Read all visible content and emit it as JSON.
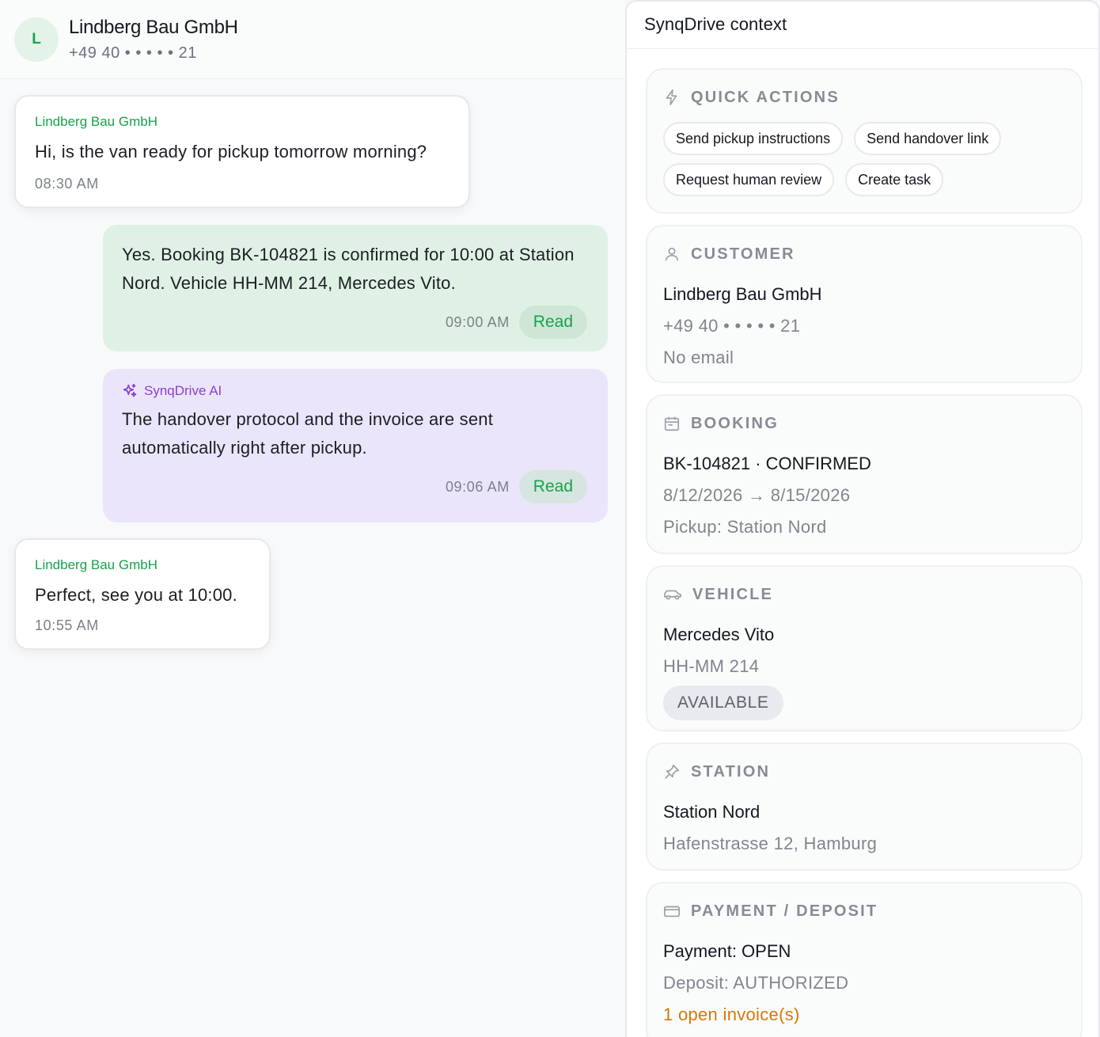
{
  "chat": {
    "header": {
      "avatar_letter": "L",
      "name": "Lindberg Bau GmbH",
      "phone": "+49 40 • • •  • • 21"
    },
    "messages": [
      {
        "sender": "Lindberg Bau GmbH",
        "text": "Hi, is the van ready for pickup tomorrow morning?",
        "time": "08:30 AM"
      },
      {
        "text": "Yes. Booking BK-104821 is confirmed for 10:00 at Station Nord. Vehicle HH-MM 214, Mercedes Vito.",
        "time": "09:00 AM",
        "status": "Read"
      },
      {
        "sender": "SynqDrive AI",
        "text": "The handover protocol and the invoice are sent automatically right after pickup.",
        "time": "09:06 AM",
        "status": "Read"
      },
      {
        "sender": "Lindberg Bau GmbH",
        "text": "Perfect, see you at 10:00.",
        "time": "10:55 AM"
      }
    ]
  },
  "context": {
    "title": "SynqDrive context",
    "quick_actions": {
      "heading": "QUICK ACTIONS",
      "buttons": [
        "Send pickup instructions",
        "Send handover link",
        "Request human review",
        "Create task"
      ]
    },
    "customer": {
      "heading": "CUSTOMER",
      "name": "Lindberg Bau GmbH",
      "phone": "+49 40 • • •  • • 21",
      "email": "No email"
    },
    "booking": {
      "heading": "BOOKING",
      "id_status": "BK-104821 · CONFIRMED",
      "dates": "8/12/2026 → 8/15/2026",
      "pickup": "Pickup: Station Nord"
    },
    "vehicle": {
      "heading": "VEHICLE",
      "model": "Mercedes Vito",
      "plate": "HH-MM 214",
      "status": "AVAILABLE"
    },
    "station": {
      "heading": "STATION",
      "name": "Station Nord",
      "address": "Hafenstrasse 12, Hamburg"
    },
    "payment": {
      "heading": "PAYMENT / DEPOSIT",
      "payment": "Payment: OPEN",
      "deposit": "Deposit: AUTHORIZED",
      "invoices": "1 open invoice(s)"
    }
  },
  "colors": {
    "brand_green": "#16a34a",
    "ai_purple": "#8b3fd6",
    "warning_orange": "#d97706",
    "outgoing_bubble": "#dff1e4",
    "ai_bubble": "#ebe5fb"
  }
}
